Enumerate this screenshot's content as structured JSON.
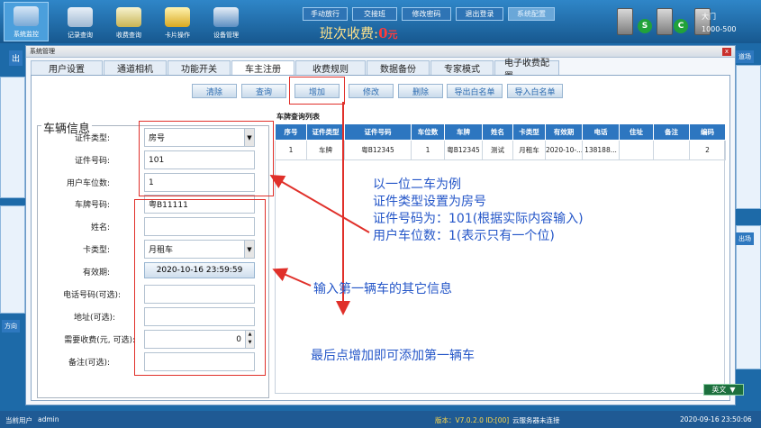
{
  "topbar": {
    "buttons": [
      {
        "label": "系统监控",
        "icon": "monitor-icon"
      },
      {
        "label": "记录查询",
        "icon": "record-search-icon"
      },
      {
        "label": "收费查询",
        "icon": "fee-search-icon"
      },
      {
        "label": "卡片操作",
        "icon": "card-icon"
      },
      {
        "label": "设备管理",
        "icon": "device-icon"
      }
    ],
    "menu": [
      "手动放行",
      "交接班",
      "修改密码",
      "退出登录",
      "系统配置"
    ],
    "shift_label": "班次收费:",
    "shift_amount": "0",
    "shift_unit": "元",
    "gate_name": "大门",
    "gate_code": "1000-500",
    "status_balls": [
      "S",
      "C"
    ]
  },
  "sidebar": {
    "tags": [
      "出",
      "方向"
    ],
    "right_tags": [
      "道场",
      "出场"
    ]
  },
  "dialog": {
    "title": "系统管理",
    "close_label": "x",
    "tabs": [
      "用户设置",
      "通道相机",
      "功能开关",
      "车主注册",
      "收费规则",
      "数据备份",
      "专家模式",
      "电子收费配置"
    ],
    "toolbar": [
      "清除",
      "查询",
      "增加",
      "修改",
      "删除",
      "导出白名单",
      "导入白名单"
    ],
    "group_title": "车辆信息",
    "fields": [
      {
        "label": "证件类型:",
        "value": "房号"
      },
      {
        "label": "证件号码:",
        "value": "101"
      },
      {
        "label": "用户车位数:",
        "value": "1"
      },
      {
        "label": "车牌号码:",
        "value": "粤B11111"
      },
      {
        "label": "姓名:",
        "value": ""
      },
      {
        "label": "卡类型:",
        "value": "月租车"
      },
      {
        "label": "有效期:",
        "value": "2020-10-16  23:59:59"
      },
      {
        "label": "电话号码(可选):",
        "value": ""
      },
      {
        "label": "地址(可选):",
        "value": ""
      },
      {
        "label": "需要收费(元, 可选):",
        "value": "0"
      },
      {
        "label": "备注(可选):",
        "value": ""
      }
    ],
    "list_title": "车牌查询列表",
    "table": {
      "headers": [
        "序号",
        "证件类型",
        "证件号码",
        "车位数",
        "车牌",
        "姓名",
        "卡类型",
        "有效期",
        "电话",
        "住址",
        "备注",
        "编码"
      ],
      "rows": [
        [
          "1",
          "车牌",
          "粤B12345",
          "1",
          "粤B12345",
          "测试",
          "月租车",
          "2020-10-...",
          "138188...",
          "",
          "",
          "2"
        ]
      ]
    }
  },
  "annotations": {
    "note1": [
      "以一位二车为例",
      "证件类型设置为房号",
      "证件号码为：101(根据实际内容输入)",
      "用户车位数：1(表示只有一个位)"
    ],
    "note2": "输入第一辆车的其它信息",
    "note3": "最后点增加即可添加第一辆车"
  },
  "statusbar": {
    "user_label": "当前用户",
    "user_name": "admin",
    "version": "版本：V7.0.2.0 ID:[00]",
    "server_status": "云服务器未连接",
    "datetime": "2020-09-16 23:50:06"
  },
  "language": "英文",
  "colors": {
    "accent": "#2d76c0",
    "annotation_red": "#e0302a",
    "annotation_blue": "#2456c8"
  }
}
